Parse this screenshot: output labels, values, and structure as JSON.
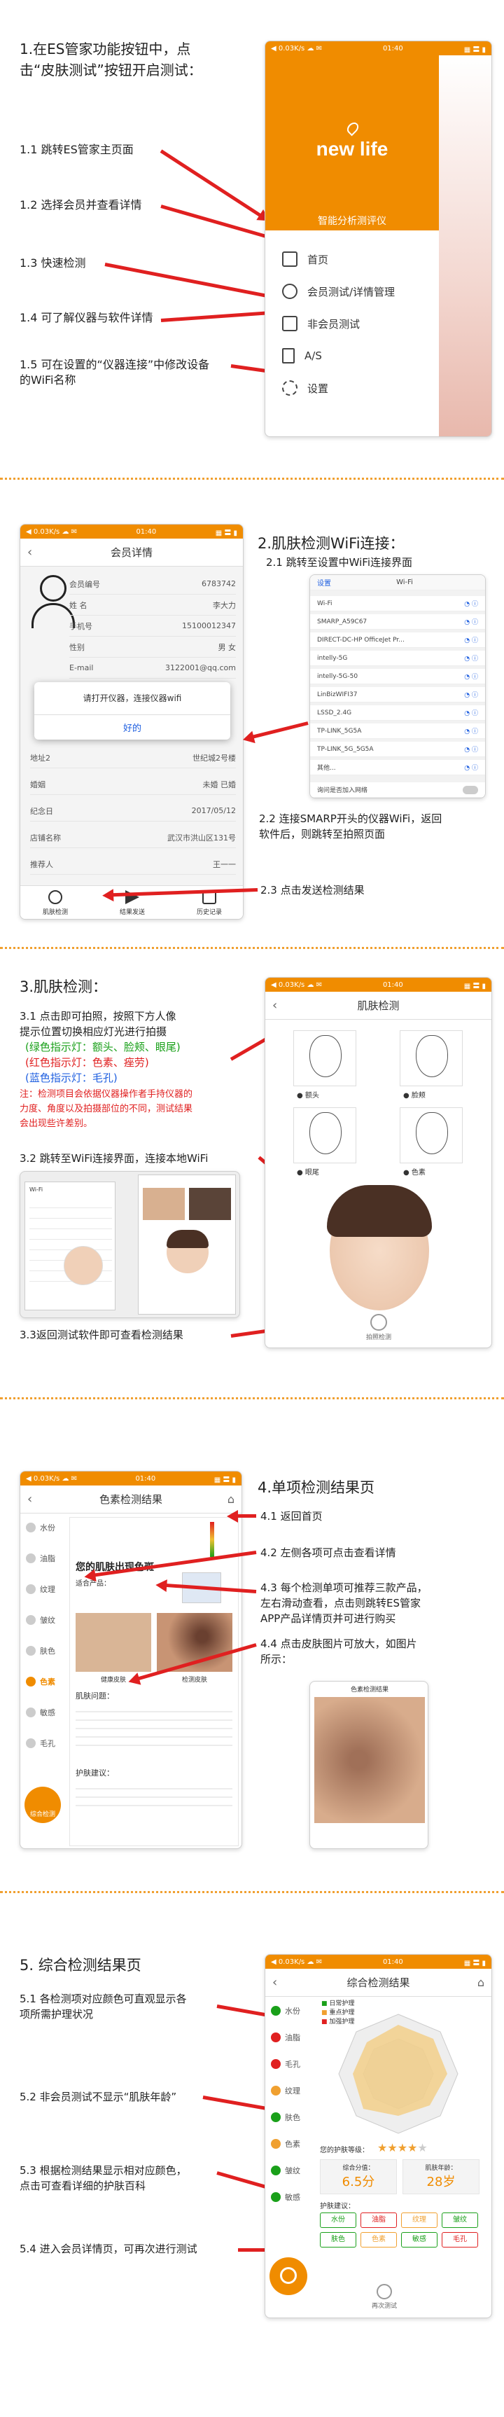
{
  "colors": {
    "accent": "#f08c00",
    "annotation": "#e02020"
  },
  "status_bar": {
    "left": "◀ 0.03K/s ☁ ✉",
    "time": "01:40",
    "right": "▦ 〓 ▮"
  },
  "s1": {
    "title": "1.在ES管家功能按钮中，点\n击“皮肤测试”按钮开启测试：",
    "notes": [
      "1.1 跳转ES管家主页面",
      "1.2 选择会员并查看详情",
      "1.3 快速检测",
      "1.4 可了解仪器与软件详情",
      "1.5 可在设置的“仪器连接”中修改设备\n的WiFi名称"
    ],
    "logo": "new life",
    "subtitle": "智能分析测评仪",
    "menu": [
      "首页",
      "会员测试/详情管理",
      "非会员测试",
      "A/S",
      "设置"
    ]
  },
  "s2": {
    "title": "2.肌肤检测WiFi连接：",
    "notes": [
      "2.1 跳转至设置中WiFi连接界面",
      "2.2 连接SMARP开头的仪器WiFi，返回\n软件后，则跳转至拍照页面",
      "2.3 点击发送检测结果"
    ],
    "screen_title": "会员详情",
    "fields": [
      {
        "k": "会员编号",
        "v": "6783742"
      },
      {
        "k": "姓  名",
        "v": "李大力"
      },
      {
        "k": "手机号",
        "v": "15100012347"
      },
      {
        "k": "性别",
        "v": "男  女"
      },
      {
        "k": "E-mail",
        "v": "3122001@qq.com"
      }
    ],
    "fields2": [
      {
        "k": "地址2",
        "v": "世纪城2号楼"
      },
      {
        "k": "婚姻",
        "v": "未婚  已婚"
      },
      {
        "k": "纪念日",
        "v": "2017/05/12"
      },
      {
        "k": "店铺名称",
        "v": "武汉市洪山区131号"
      },
      {
        "k": "推荐人",
        "v": "王一一"
      }
    ],
    "dialog_text": "请打开仪器，连接仪器wifi",
    "dialog_ok": "好的",
    "bottom": [
      "肌肤检测",
      "结果发送",
      "历史记录"
    ],
    "wifi_header": "Wi-Fi",
    "wifi_back": "设置",
    "wifi_list": [
      "Wi-Fi",
      "SMARP_A59C67",
      "DIRECT-DC-HP OfficeJet Pr...",
      "intelly-5G",
      "intelly-5G-50",
      "LinBizWIFI37",
      "LSSD_2.4G",
      "TP-LINK_5G5A",
      "TP-LINK_5G_5G5A",
      "其他..."
    ],
    "wifi_ask": "询问是否加入网络"
  },
  "s3": {
    "title": "3.肌肤检测：",
    "note1": "3.1 点击即可拍照，按照下方人像\n提示位置切换相应灯光进行拍摄",
    "note_green": "(绿色指示灯：额头、脸颊、眼尾)",
    "note_red": "(红色指示灯：色素、痤劳)",
    "note_blue": "(蓝色指示灯：毛孔)",
    "warn": "注：检测项目会依据仪器操作者手持仪器的\n力度、角度以及拍摄部位的不同，测试结果\n会出现些许差别。",
    "note2": "3.2 跳转至WiFi连接界面，连接本地WiFi",
    "note3": "3.3返回测试软件即可查看检测结果",
    "screen_title": "肌肤检测",
    "faces": [
      "● 额头",
      "● 脸颊",
      "● 眼尾",
      "● 色素"
    ],
    "capture": "拍照检测"
  },
  "s4": {
    "title": "4.单项检测结果页",
    "notes": [
      "4.1 返回首页",
      "4.2 左侧各项可点击查看详情",
      "4.3 每个检测单项可推荐三款产品，\n左右滑动查看，点击则跳转ES管家\nAPP产品详情页并可进行购买",
      "4.4 点击皮肤图片可放大，如图片\n所示："
    ],
    "screen_title": "色素检测结果",
    "side": [
      "水份",
      "油脂",
      "纹理",
      "皱纹",
      "肤色",
      "色素",
      "敏感",
      "毛孔"
    ],
    "result_head": "您的肌肤出现色斑",
    "suggest": "适合产品：",
    "photos": [
      "健康皮肤",
      "检测皮肤"
    ],
    "analysis": "肌肤问题：",
    "care": "护肤建议：",
    "fab": "综合检测"
  },
  "s5": {
    "title": "5. 综合检测结果页",
    "notes": [
      "5.1 各检测项对应颜色可直观显示各\n项所需护理状况",
      "5.2 非会员测试不显示“肌肤年龄”",
      "5.3 根据检测结果显示相对应颜色，\n点击可查看详细的护肤百科",
      "5.4 进入会员详情页，可再次进行测试"
    ],
    "screen_title": "综合检测结果",
    "legend": [
      "日常护理",
      "重点护理",
      "加强护理"
    ],
    "side": [
      "水份",
      "油脂",
      "毛孔",
      "纹理",
      "肤色",
      "色素",
      "皱纹",
      "敏感"
    ],
    "score_label": "综合分值：",
    "score": "6.5分",
    "age_label": "肌肤年龄：",
    "age": "28岁",
    "rating": "您的护肤等级：",
    "care_label": "护肤建议：",
    "chips": [
      "水份",
      "油脂",
      "纹理",
      "皱纹",
      "肤色",
      "色素",
      "敏感",
      "毛孔"
    ],
    "again": "再次测试"
  }
}
